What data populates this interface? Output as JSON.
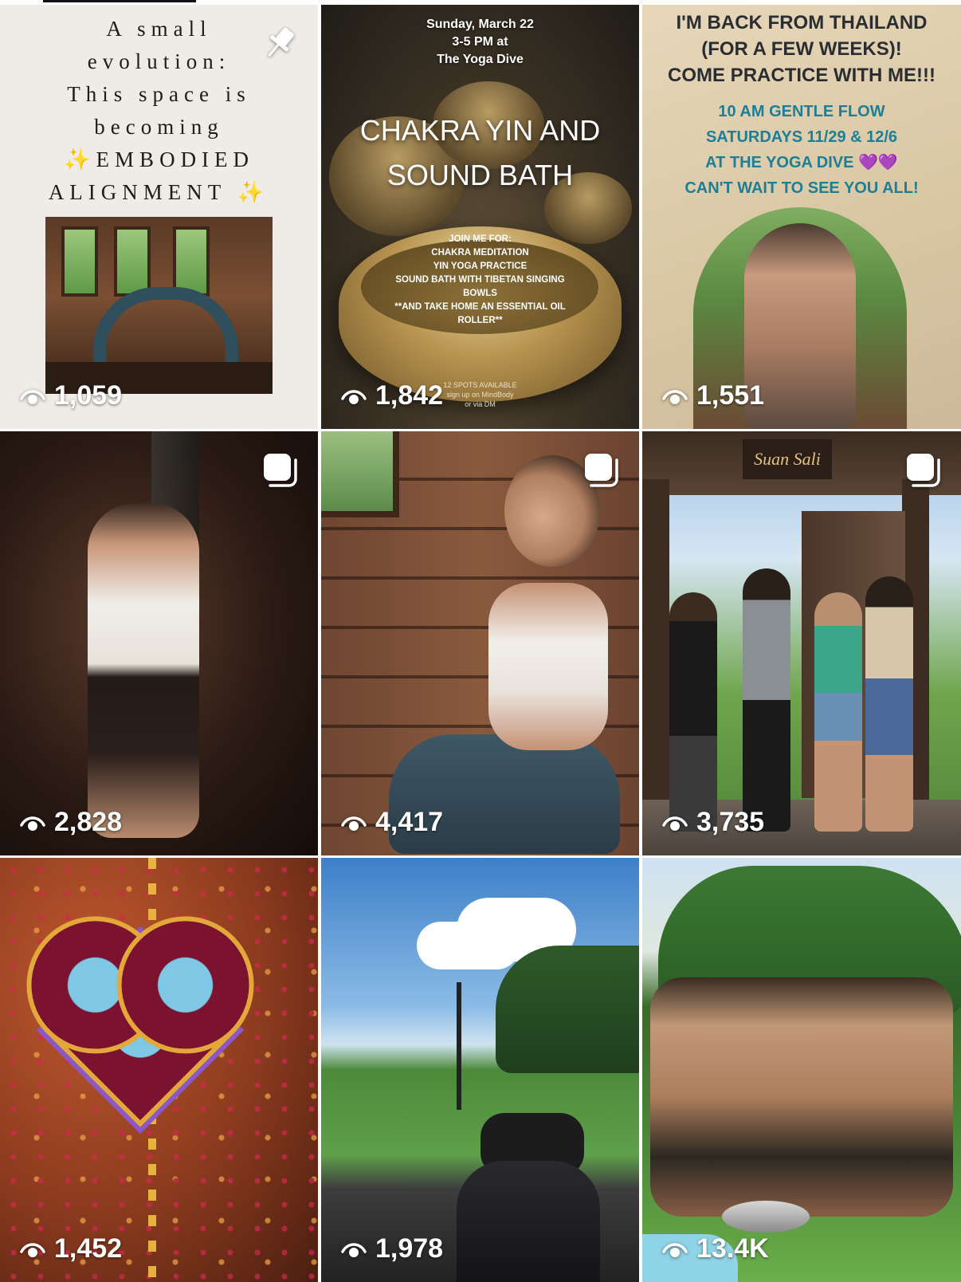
{
  "posts": [
    {
      "views": "1,059",
      "pinned": true,
      "caption_lines": [
        "A small",
        "evolution:",
        "This space is",
        "becoming"
      ],
      "caption_highlight_1": "✨EMBODIED",
      "caption_highlight_2": "ALIGNMENT ✨"
    },
    {
      "views": "1,842",
      "date_line_1": "Sunday, March 22",
      "date_line_2": "3-5 PM at",
      "date_line_3": "The Yoga Dive",
      "headline_1": "CHAKRA YIN AND",
      "headline_2": "SOUND BATH",
      "list": [
        "JOIN ME FOR:",
        "CHAKRA MEDITATION",
        "YIN YOGA PRACTICE",
        "SOUND BATH WITH TIBETAN SINGING",
        "BOWLS",
        "**AND TAKE HOME AN ESSENTIAL OIL",
        "ROLLER**"
      ],
      "spots_1": "12 SPOTS AVAILABLE",
      "spots_2": "sign up on MindBody",
      "spots_3": "or via DM"
    },
    {
      "views": "1,551",
      "heading": [
        "I'M BACK FROM THAILAND",
        "(FOR A FEW WEEKS)!",
        "COME PRACTICE WITH ME!!!"
      ],
      "details": [
        "10 AM GENTLE FLOW",
        "SATURDAYS 11/29 & 12/6",
        "AT THE YOGA DIVE 💜💜",
        "CAN'T WAIT TO SEE YOU ALL!"
      ]
    },
    {
      "views": "2,828",
      "multi": true
    },
    {
      "views": "4,417",
      "multi": true
    },
    {
      "views": "3,735",
      "multi": true,
      "sign_text": "Suan Sali"
    },
    {
      "views": "1,452"
    },
    {
      "views": "1,978"
    },
    {
      "views": "13.4K"
    }
  ],
  "icons": {
    "views": "eye-icon",
    "pinned": "pin-icon",
    "multi": "carousel-icon"
  }
}
